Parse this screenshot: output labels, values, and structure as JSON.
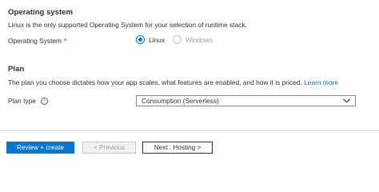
{
  "os_section": {
    "title": "Operating system",
    "description": "Linux is the only supported Operating System for your selection of runtime stack.",
    "field_label": "Operating System",
    "required_marker": "*",
    "options": [
      {
        "label": "Linux",
        "selected": true,
        "disabled": false
      },
      {
        "label": "Windows",
        "selected": false,
        "disabled": true
      }
    ]
  },
  "plan_section": {
    "title": "Plan",
    "description": "The plan you choose dictates how your app scales, what features are enabled, and how it is priced.",
    "learn_more": "Learn more",
    "field_label": "Plan type",
    "info_icon": "i",
    "selected_value": "Consumption (Serverless)"
  },
  "footer": {
    "review_create": "Review + create",
    "previous": "< Previous",
    "next": "Next : Hosting >"
  },
  "colors": {
    "accent": "#0078d4",
    "required": "#a4262c",
    "disabled_text": "#a19f9d"
  }
}
